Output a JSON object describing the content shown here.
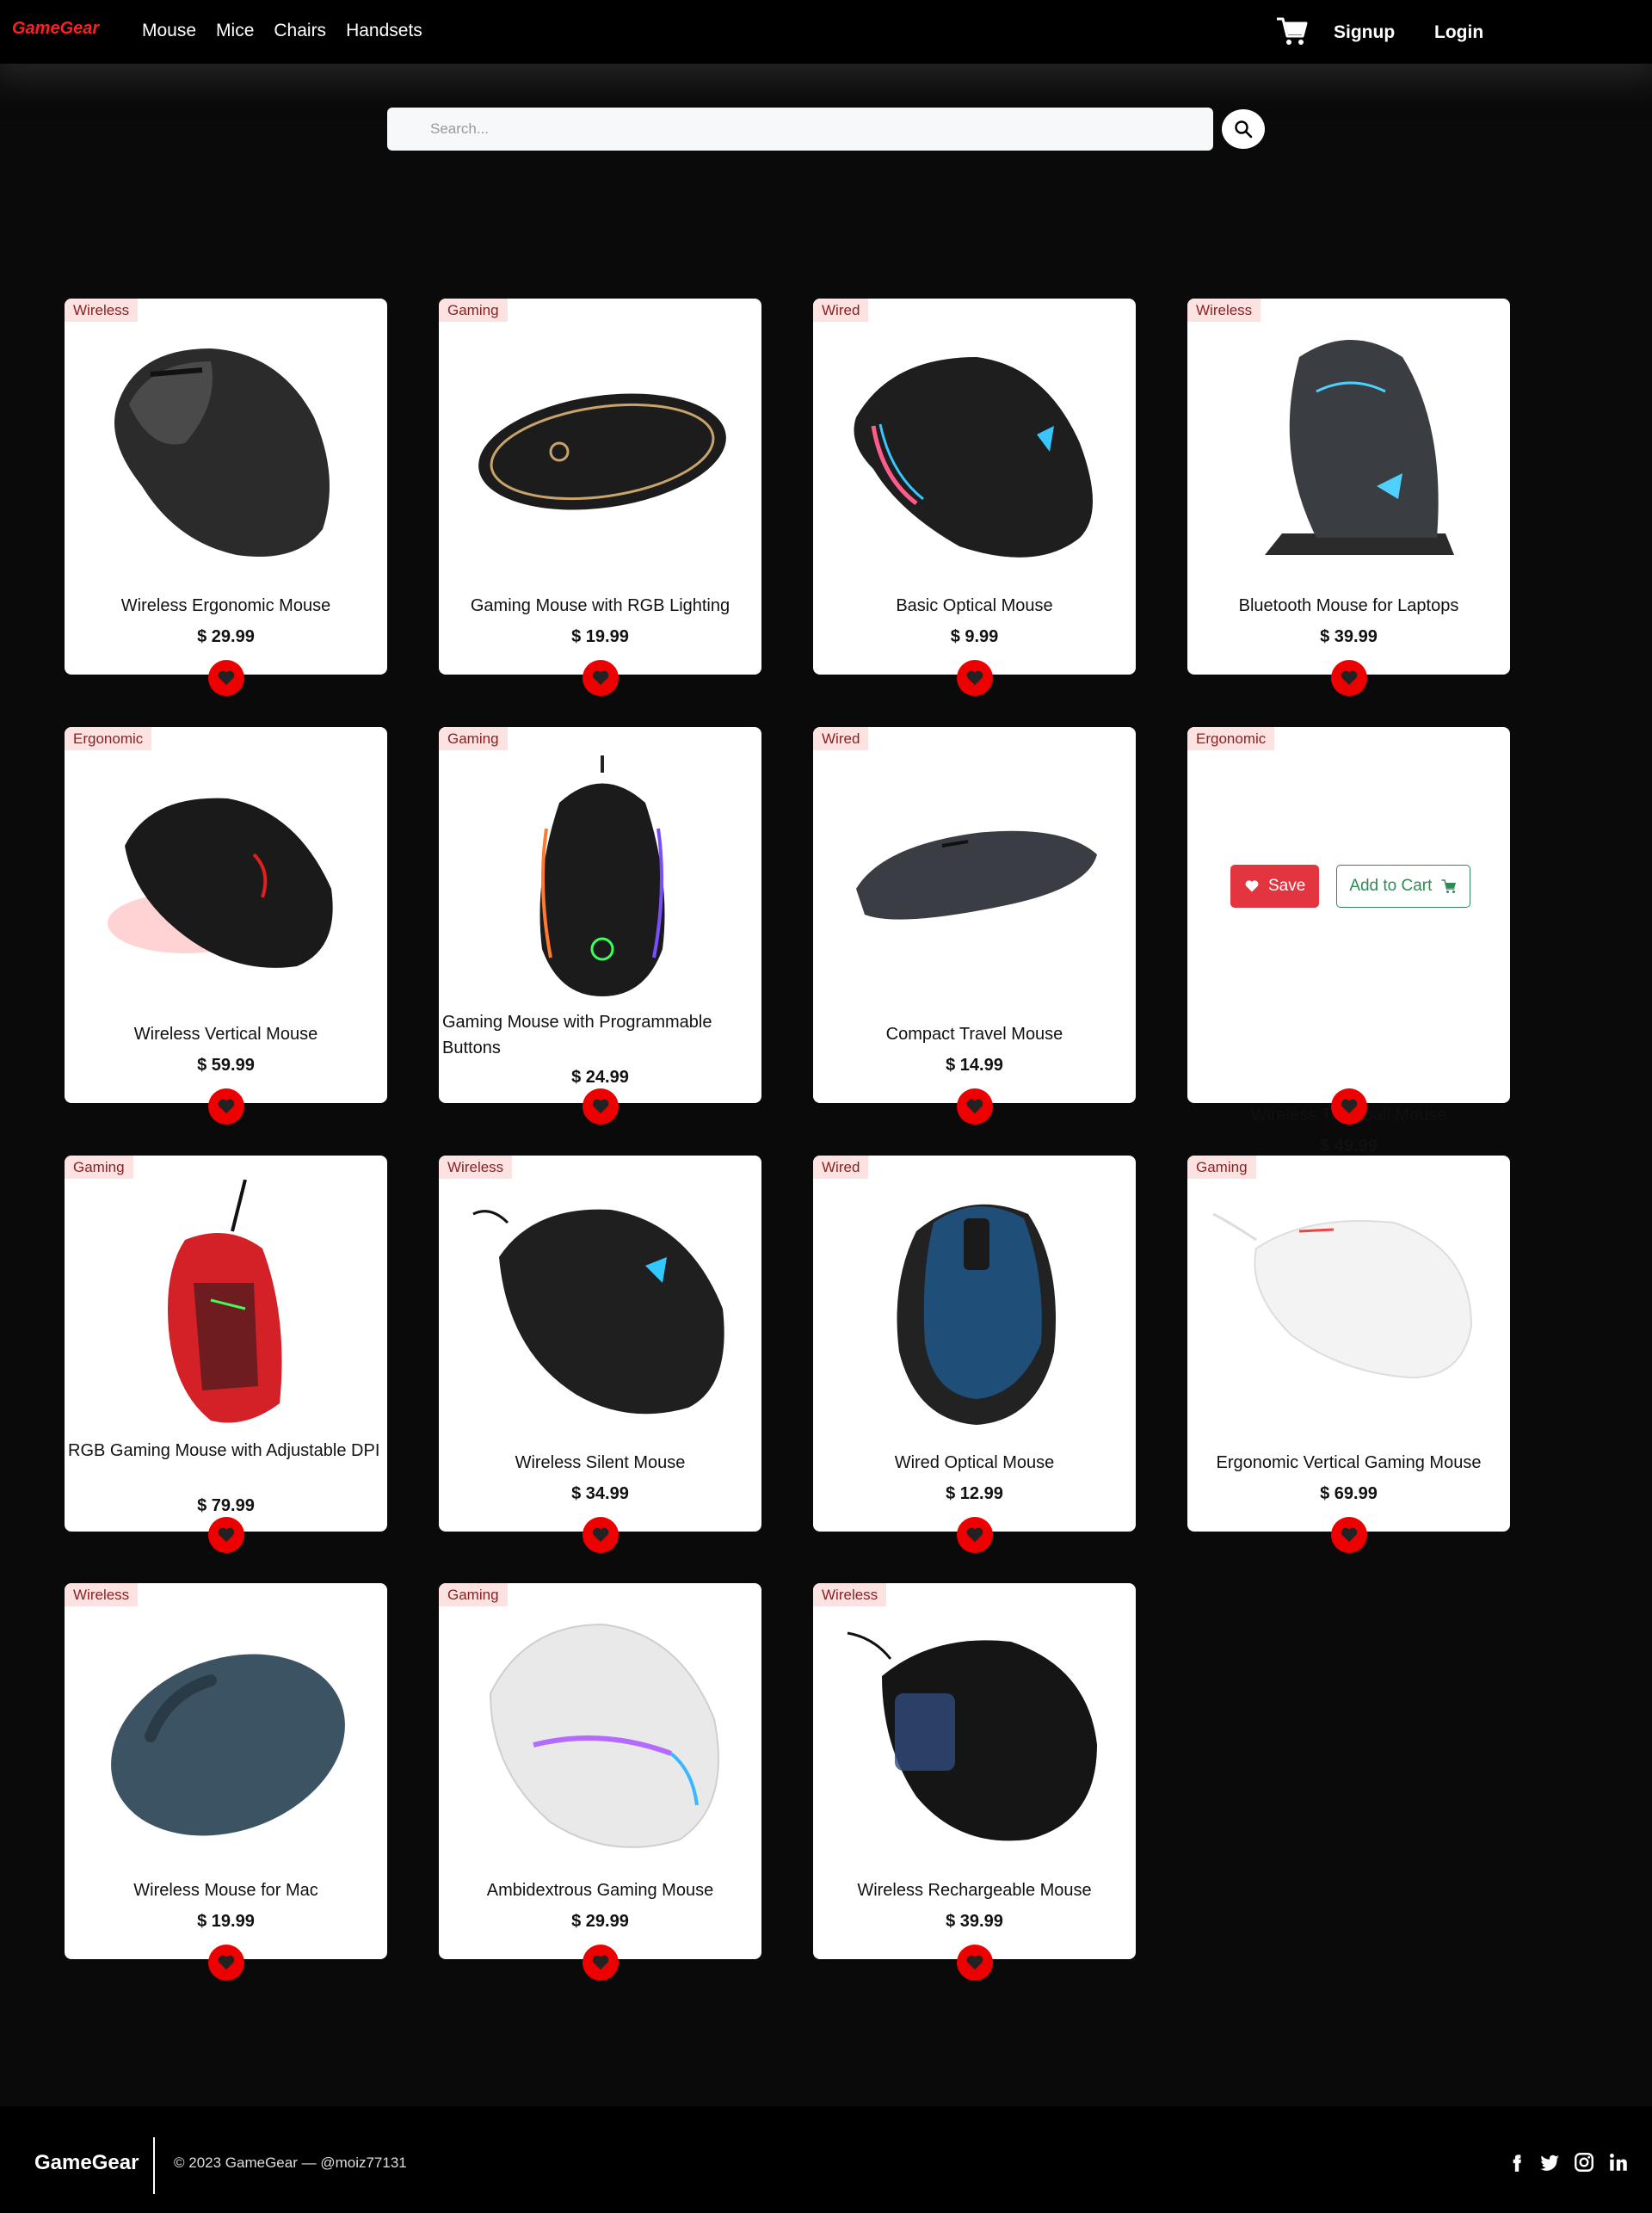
{
  "navbar": {
    "brand": "GameGear",
    "links": [
      "Mouse",
      "Mice",
      "Chairs",
      "Handsets"
    ],
    "signup": "Signup",
    "login": "Login"
  },
  "search": {
    "placeholder": "Search..."
  },
  "products": [
    {
      "category": "Wireless",
      "name": "Wireless Ergonomic Mouse",
      "price": "$ 29.99"
    },
    {
      "category": "Gaming",
      "name": "Gaming Mouse with RGB Lighting",
      "price": "$ 19.99"
    },
    {
      "category": "Wired",
      "name": "Basic Optical Mouse",
      "price": "$ 9.99"
    },
    {
      "category": "Wireless",
      "name": "Bluetooth Mouse for Laptops",
      "price": "$ 39.99"
    },
    {
      "category": "Ergonomic",
      "name": "Wireless Vertical Mouse",
      "price": "$ 59.99"
    },
    {
      "category": "Gaming",
      "name": "Gaming Mouse with Programmable Buttons",
      "price": "$ 24.99"
    },
    {
      "category": "Wired",
      "name": "Compact Travel Mouse",
      "price": "$ 14.99"
    },
    {
      "category": "Ergonomic",
      "name": "Wireless Trackball Mouse",
      "price": "$ 49.99",
      "save_label": "Save",
      "cart_label": "Add to Cart"
    },
    {
      "category": "Gaming",
      "name": "RGB Gaming Mouse with Adjustable DPI",
      "price": "$ 79.99"
    },
    {
      "category": "Wireless",
      "name": "Wireless Silent Mouse",
      "price": "$ 34.99"
    },
    {
      "category": "Wired",
      "name": "Wired Optical Mouse",
      "price": "$ 12.99"
    },
    {
      "category": "Gaming",
      "name": "Ergonomic Vertical Gaming Mouse",
      "price": "$ 69.99"
    },
    {
      "category": "Wireless",
      "name": "Wireless Mouse for Mac",
      "price": "$ 19.99"
    },
    {
      "category": "Gaming",
      "name": "Ambidextrous Gaming Mouse",
      "price": "$ 29.99"
    },
    {
      "category": "Wireless",
      "name": "Wireless Rechargeable Mouse",
      "price": "$ 39.99"
    }
  ],
  "footer": {
    "brand": "GameGear",
    "copyright": "© 2023 GameGear — @moiz77131",
    "social_icons": [
      "facebook-icon",
      "twitter-icon",
      "instagram-icon",
      "linkedin-icon"
    ]
  },
  "colors": {
    "brand": "#ff1f1f",
    "background": "#0a0a0a",
    "favorite": "#ee0000",
    "save": "#e3353f",
    "cart": "#2f8a57",
    "badge_bg": "#fde2e2"
  }
}
